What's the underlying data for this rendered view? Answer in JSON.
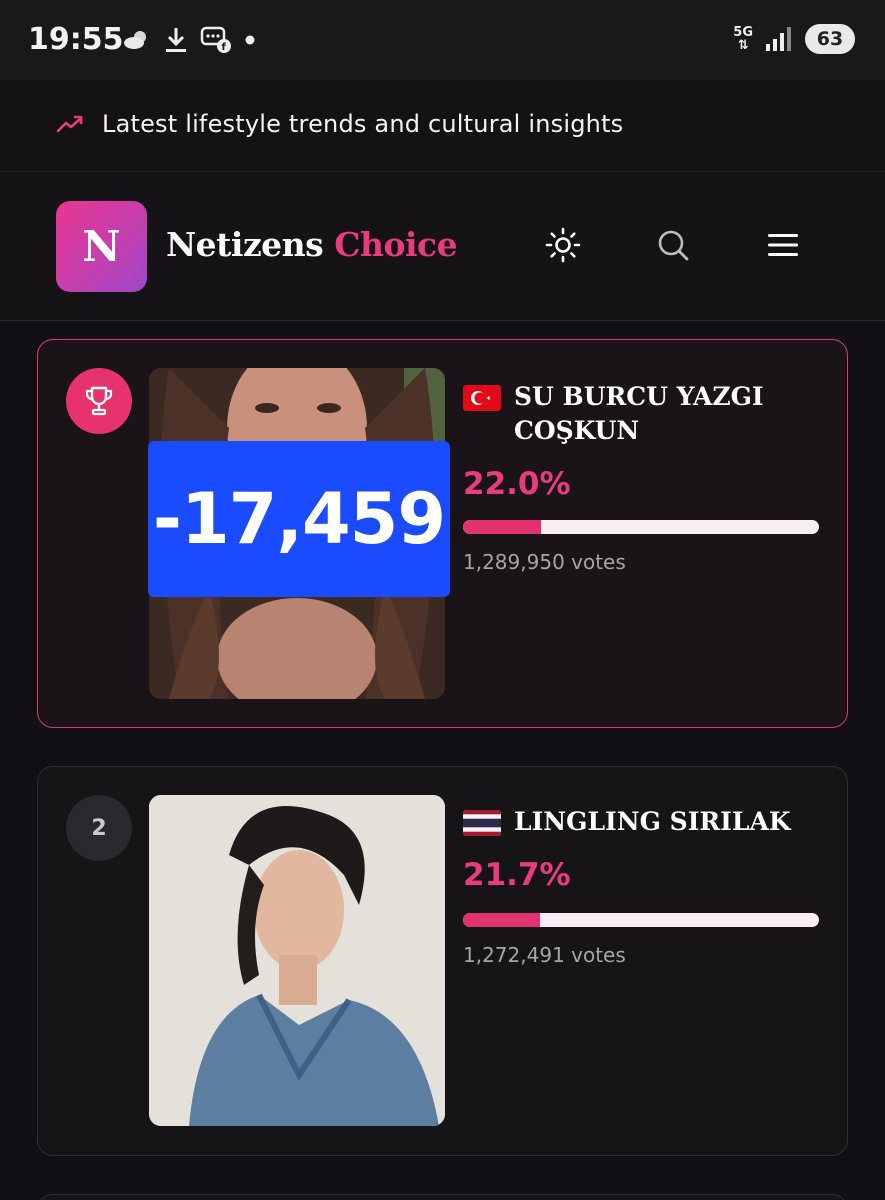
{
  "status_bar": {
    "time": "19:55",
    "network": "5G",
    "battery": "63"
  },
  "banner": {
    "text": "Latest lifestyle trends and cultural insights"
  },
  "header": {
    "logo_letter": "N",
    "brand_part1": "Netizens",
    "brand_part2": "Choice"
  },
  "entries": [
    {
      "rank": "",
      "name_line1": "SU BURCU YAZGI",
      "name_line2": "COŞKUN",
      "country": "Turkey",
      "percent": "22.0%",
      "bar_fill": 0.22,
      "votes": "1,289,950 votes",
      "overlay": "-17,459"
    },
    {
      "rank": "2",
      "name_line1": "LINGLING SIRILAK",
      "country": "Thailand",
      "percent": "21.7%",
      "bar_fill": 0.217,
      "votes": "1,272,491 votes"
    }
  ],
  "colors": {
    "accent": "#ea3b7c",
    "overlay_blue": "#1a4bff",
    "background": "#131015"
  }
}
